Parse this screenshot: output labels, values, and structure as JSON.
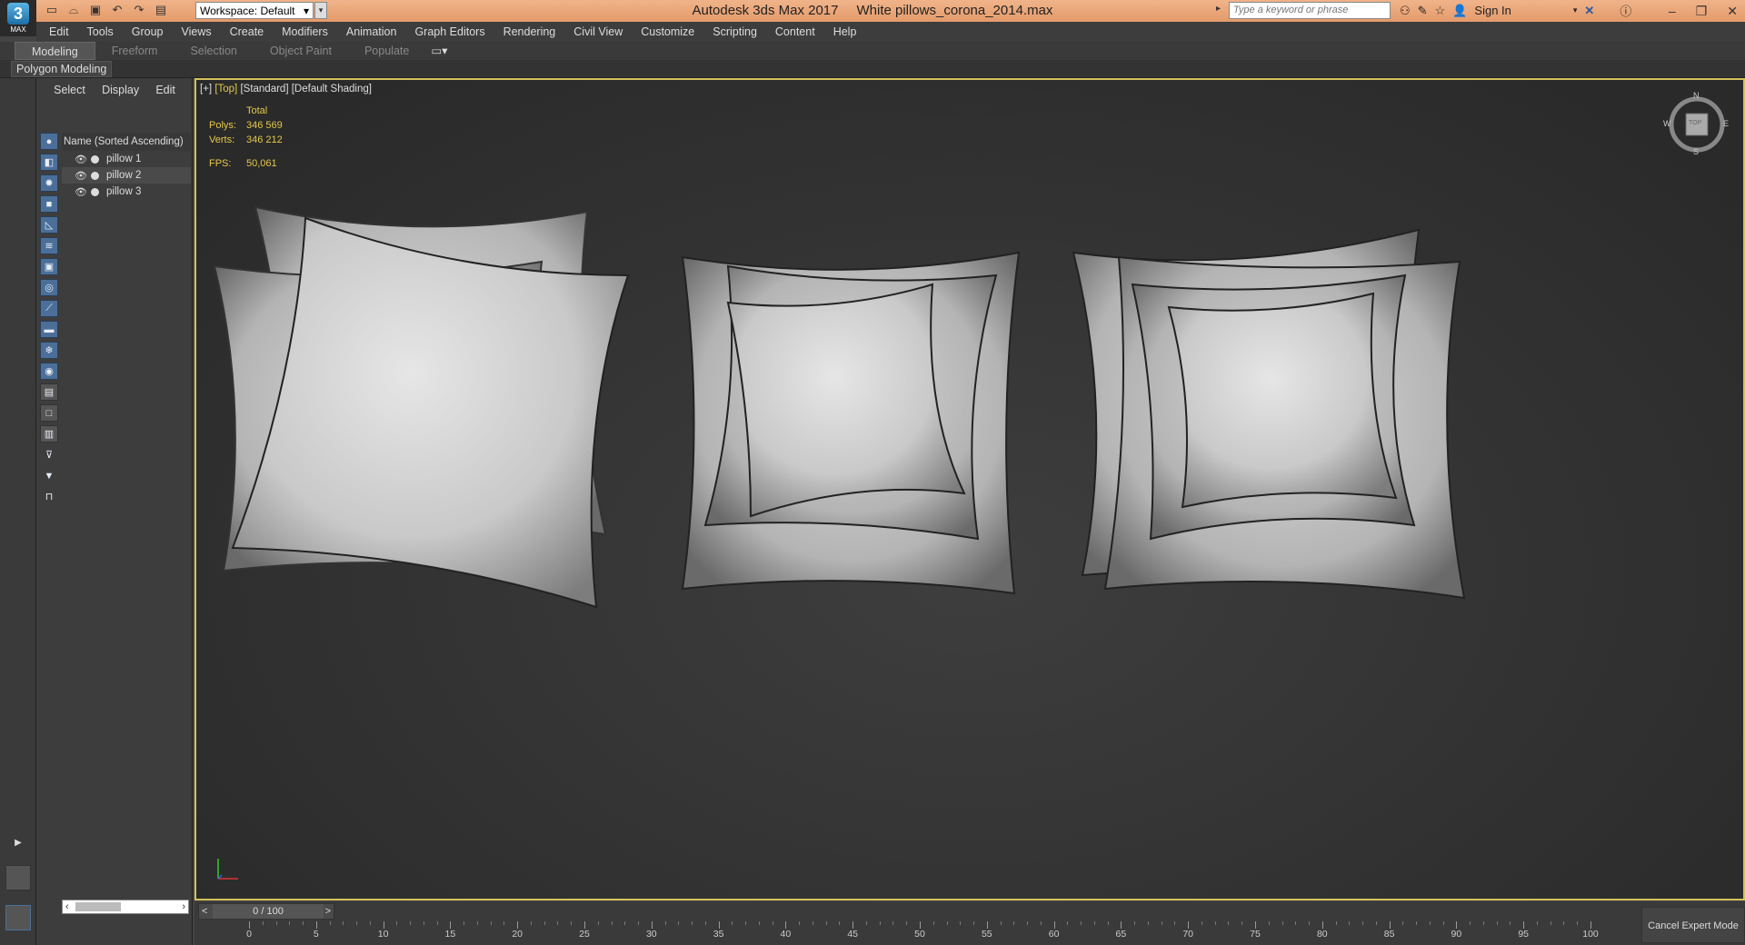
{
  "app": {
    "name": "Autodesk 3ds Max 2017",
    "file": "White pillows_corona_2014.max",
    "logo_letter": "3",
    "logo_sub": "MAX"
  },
  "workspace": {
    "label": "Workspace: Default"
  },
  "search": {
    "placeholder": "Type a keyword or phrase"
  },
  "signin": "Sign In",
  "menu": [
    "Edit",
    "Tools",
    "Group",
    "Views",
    "Create",
    "Modifiers",
    "Animation",
    "Graph Editors",
    "Rendering",
    "Civil View",
    "Customize",
    "Scripting",
    "Content",
    "Help"
  ],
  "ribbon_tabs": [
    "Modeling",
    "Freeform",
    "Selection",
    "Object Paint",
    "Populate"
  ],
  "ribbon_panel": "Polygon Modeling",
  "scene_explorer": {
    "tabs": [
      "Select",
      "Display",
      "Edit"
    ],
    "column": "Name (Sorted Ascending)",
    "items": [
      "pillow 1",
      "pillow 2",
      "pillow 3"
    ]
  },
  "viewport": {
    "label_plus": "[+]",
    "label_view": "[Top]",
    "label_std": "[Standard]",
    "label_shading": "[Default Shading]",
    "stats_header": "Total",
    "polys_label": "Polys:",
    "polys": "346 569",
    "verts_label": "Verts:",
    "verts": "346 212",
    "fps_label": "FPS:",
    "fps": "50,061",
    "cube_n": "N",
    "cube_s": "S",
    "cube_e": "E",
    "cube_w": "W",
    "cube_face": "TOP"
  },
  "timeline": {
    "frame": "0 / 100",
    "prev": "<",
    "next": ">",
    "ticks": [
      "0",
      "5",
      "10",
      "15",
      "20",
      "25",
      "30",
      "35",
      "40",
      "45",
      "50",
      "55",
      "60",
      "65",
      "70",
      "75",
      "80",
      "85",
      "90",
      "95",
      "100"
    ]
  },
  "cancel_expert": "Cancel Expert Mode",
  "colors": {
    "title_bar": "#e9a679",
    "viewport_border": "#d4c25a",
    "stats_text": "#e6c84a"
  }
}
